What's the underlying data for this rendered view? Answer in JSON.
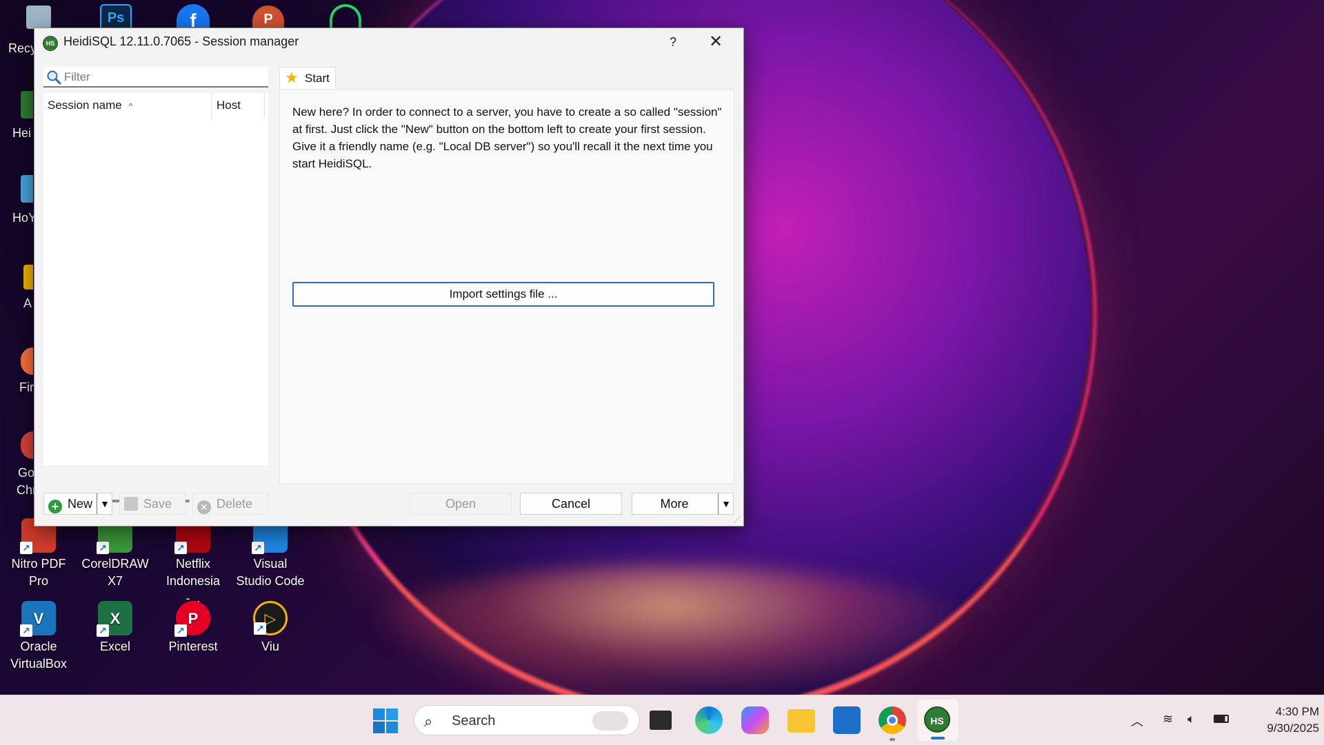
{
  "window": {
    "title": "HeidiSQL 12.11.0.7065 - Session manager",
    "app_icon_text": "HS",
    "help_label": "?",
    "close_label": "✕"
  },
  "filter": {
    "placeholder": "Filter"
  },
  "session_list": {
    "columns": [
      "Session name",
      "Host"
    ],
    "sort_indicator": "^",
    "rows": []
  },
  "left_buttons": {
    "new_label": "New",
    "save_label": "Save",
    "delete_label": "Delete"
  },
  "tabs": [
    {
      "label": "Start",
      "icon": "star-icon"
    }
  ],
  "start_panel": {
    "intro_text": "New here? In order to connect to a server, you have to create a so called \"session\" at first. Just click the \"New\" button on the bottom left to create your first session. Give it a friendly name (e.g. \"Local DB server\") so you'll recall it the next time you start HeidiSQL.",
    "import_label": "Import settings file ..."
  },
  "right_buttons": {
    "open_label": "Open",
    "cancel_label": "Cancel",
    "more_label": "More"
  },
  "desktop_icons": [
    {
      "label": "Nitro PDF Pro",
      "color": "#d63b2a",
      "glyph": "N"
    },
    {
      "label": "CorelDRAW X7",
      "color": "#3a9a3a",
      "glyph": "C"
    },
    {
      "label": "Netflix Indonesia -...",
      "color": "#b20710",
      "glyph": "N"
    },
    {
      "label": "Visual Studio Code",
      "color": "#1e88e5",
      "glyph": "<>"
    },
    {
      "label": "Oracle VirtualBox",
      "color": "#1b75bb",
      "glyph": "V"
    },
    {
      "label": "Excel",
      "color": "#1d7044",
      "glyph": "X"
    },
    {
      "label": "Pinterest",
      "color": "#e60023",
      "glyph": "P"
    },
    {
      "label": "Viu",
      "color": "#f5b400",
      "glyph": "▷"
    }
  ],
  "desktop_partial_labels": [
    "Recy",
    "Hei",
    "HoY",
    "A",
    "Fir",
    "Go",
    "Chr"
  ],
  "taskbar": {
    "search_label": "Search",
    "clock_time": "4:30 PM",
    "clock_date": "9/30/2025",
    "heidisql_label": "HS"
  }
}
